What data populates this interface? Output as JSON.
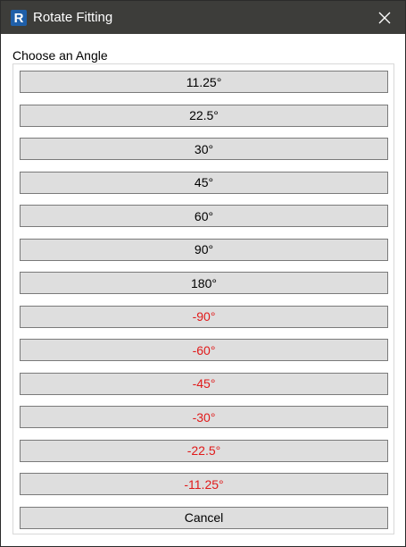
{
  "window": {
    "title": "Rotate Fitting",
    "app_icon_letter": "R",
    "close_icon": "close-icon"
  },
  "dialog": {
    "prompt": "Choose an Angle",
    "angle_buttons": [
      {
        "label": "11.25°",
        "negative": false
      },
      {
        "label": "22.5°",
        "negative": false
      },
      {
        "label": "30°",
        "negative": false
      },
      {
        "label": "45°",
        "negative": false
      },
      {
        "label": "60°",
        "negative": false
      },
      {
        "label": "90°",
        "negative": false
      },
      {
        "label": "180°",
        "negative": false
      },
      {
        "label": "-90°",
        "negative": true
      },
      {
        "label": "-60°",
        "negative": true
      },
      {
        "label": "-45°",
        "negative": true
      },
      {
        "label": "-30°",
        "negative": true
      },
      {
        "label": "-22.5°",
        "negative": true
      },
      {
        "label": "-11.25°",
        "negative": true
      }
    ],
    "cancel_label": "Cancel"
  },
  "colors": {
    "titlebar": "#3d3d3a",
    "button_face": "#dedede",
    "negative_text": "#e01a1a"
  }
}
